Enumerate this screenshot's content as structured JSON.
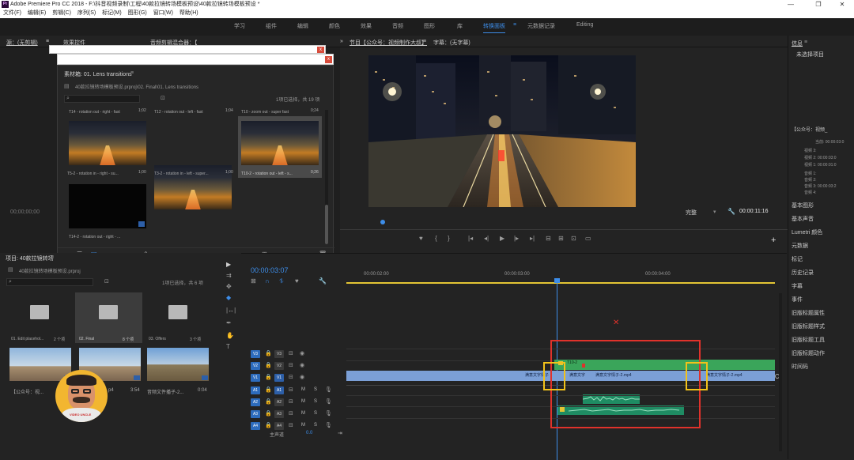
{
  "titlebar": {
    "title": "Adobe Premiere Pro CC 2018 - F:\\抖音视频录制\\工程\\40款拉镜转场模板预设\\40款拉镜转场模板预设 *",
    "logo": "Pr",
    "minimize": "—",
    "maximize": "❐",
    "close": "✕"
  },
  "menubar": [
    "文件(F)",
    "编辑(E)",
    "剪辑(C)",
    "序列(S)",
    "标记(M)",
    "图形(G)",
    "窗口(W)",
    "帮助(H)"
  ],
  "workspaces": [
    {
      "label": "学习"
    },
    {
      "label": "组件"
    },
    {
      "label": "编辑"
    },
    {
      "label": "颜色"
    },
    {
      "label": "效果"
    },
    {
      "label": "音频"
    },
    {
      "label": "图形"
    },
    {
      "label": "库"
    },
    {
      "label": "转换面板",
      "active": true
    },
    {
      "label": "≡"
    },
    {
      "label": "元数据记录"
    },
    {
      "label": "Editing"
    }
  ],
  "source_panel": {
    "tab1": "源：(无剪辑)",
    "tab2": "≡",
    "tab3": "效果控件",
    "tab4": "音频剪辑混合器：【",
    "tab5": "»",
    "tab6": "节目【公众号：视频制作大叔】",
    "tab6_menu": "≡",
    "tab7": "字幕：(无字幕)",
    "timecode": "00;00;00;00"
  },
  "program": {
    "zoom": "完整",
    "timecode": "00:00:11:16",
    "plus": "+"
  },
  "popup": {
    "close": "x"
  },
  "bin": {
    "title": "素材箱: 01. Lens transitions",
    "menu": "≡",
    "path": "40款拉镜转场模板预设.prproj\\02. Final\\01. Lens transitions",
    "search_placeholder": "",
    "selection": "1项已选择，共 19 项",
    "items": [
      {
        "name": "T14 - rotation out - right - fast",
        "dur": "1;02"
      },
      {
        "name": "T12 - rotation out - left - fast",
        "dur": "1;04"
      },
      {
        "name": "T10 - zoom out - super fast",
        "dur": "0;24"
      },
      {
        "name": "T5-2 - rotation in - right - su...",
        "dur": "1;00"
      },
      {
        "name": "T3-2 - rotation in - left - super...",
        "dur": "1;00"
      },
      {
        "name": "T10-2 - rotation out - left - s...",
        "dur": "0;26"
      },
      {
        "name": "T14-2 - rotation out - right - ...",
        "dur": ""
      }
    ]
  },
  "project": {
    "tab": "项目: 40款拉镜转场",
    "tab_menu": "≡",
    "path": "40款拉镜转场模板预设.prproj",
    "selection": "1项已选择，共 6 项",
    "folders": [
      {
        "name": "01. Edit placehol...",
        "count": "2 个项"
      },
      {
        "name": "02. Final",
        "count": "8 个项"
      },
      {
        "name": "03. Offers",
        "count": "3 个项"
      }
    ],
    "clips": [
      {
        "name": "【公众号：视...",
        "dur": ""
      },
      {
        "name": "",
        "dur": "p4"
      },
      {
        "name": "音频文件播子-2...",
        "dur": "3:54"
      },
      {
        "name": "",
        "dur": "0:04"
      }
    ],
    "avatar_label": "VIDEO UNCLE"
  },
  "timeline": {
    "timecode": "00:00:03:07",
    "ruler": [
      "00:00:02:00",
      "00:00:03:00",
      "00:00:04:00"
    ],
    "video_tracks": [
      {
        "tog": "V3",
        "name": "V3"
      },
      {
        "tog": "V2",
        "name": "V2"
      },
      {
        "tog": "V1",
        "name": "V1"
      }
    ],
    "audio_tracks": [
      {
        "tog": "A1",
        "name": "A1",
        "m": "M",
        "s": "S"
      },
      {
        "tog": "A2",
        "name": "A2",
        "m": "M",
        "s": "S"
      },
      {
        "tog": "A3",
        "name": "A3",
        "m": "M",
        "s": "S"
      },
      {
        "tog": "A4",
        "name": "A4",
        "m": "M",
        "s": "S"
      }
    ],
    "master": "主声道",
    "master_val": "0.0",
    "clip_fx": "T10-2",
    "clip_labels": [
      "满意文字情子",
      "满意文字",
      "满意文字情子-2.mp4",
      "满意文字情子-2.mp4"
    ]
  },
  "info_panel": {
    "title": "信息",
    "menu": "≡",
    "no_selection": "未选择项目",
    "seq_label": "【公众号：视频_",
    "lines": [
      "当前: 00:00:03:0",
      "视频 3:",
      "视频 2: 00:00:03:0",
      "视频 1: 00:00:01:0",
      "音频 1:",
      "音频 2:",
      "音频 3: 00:00:03:2",
      "音频 4:"
    ],
    "items": [
      "基本图形",
      "基本声音",
      "Lumetri 颜色",
      "元数据",
      "标记",
      "历史记录",
      "字幕",
      "事件",
      "旧版标题属性",
      "旧版标题样式",
      "旧版标题工具",
      "旧版标题动作",
      "时间码"
    ]
  },
  "colors": {
    "accent": "#3d8de8",
    "clip_blue": "#7b9fd6",
    "clip_green": "#3aa55a",
    "audio_green": "#1f8c63",
    "highlight_red": "#e0322b",
    "highlight_yellow": "#f2c21a",
    "ruler_yellow": "#e3c534"
  }
}
